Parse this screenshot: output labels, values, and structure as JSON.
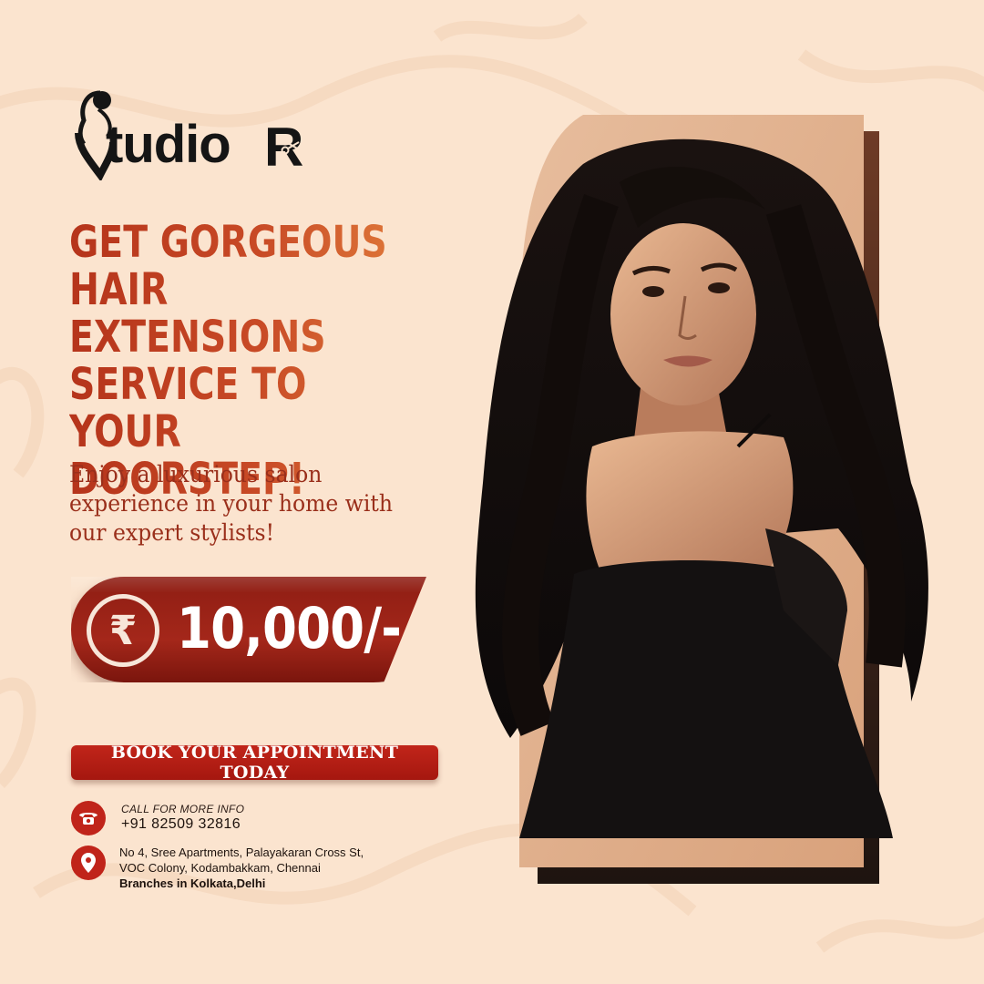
{
  "brand": {
    "logo_text": "tudio",
    "logo_letter": "R"
  },
  "headline": {
    "line1": "GET GORGEOUS",
    "line2": "HAIR EXTENSIONS",
    "line3": "SERVICE TO YOUR",
    "line4": "DOORSTEP!"
  },
  "subtext": {
    "line1": "Enjoy a luxurious salon",
    "line2": "experience in your home with",
    "line3": "our expert stylists!"
  },
  "price": {
    "currency_symbol": "₹",
    "amount": "10,000/-"
  },
  "cta": {
    "label": "BOOK YOUR APPOINTMENT TODAY"
  },
  "contact": {
    "call_label": "CALL FOR MORE INFO",
    "phone": "+91 82509 32816",
    "address_line1": "No 4, Sree Apartments, Palayakaran Cross St,",
    "address_line2": "VOC Colony, Kodambakkam, Chennai",
    "branches": "Branches in Kolkata,Delhi"
  },
  "colors": {
    "background": "#fbe4cf",
    "accent_red": "#c0241a",
    "headline_gradient_start": "#b5341b",
    "headline_gradient_end": "#e07a3a",
    "price_pill": "#8e1d13"
  }
}
